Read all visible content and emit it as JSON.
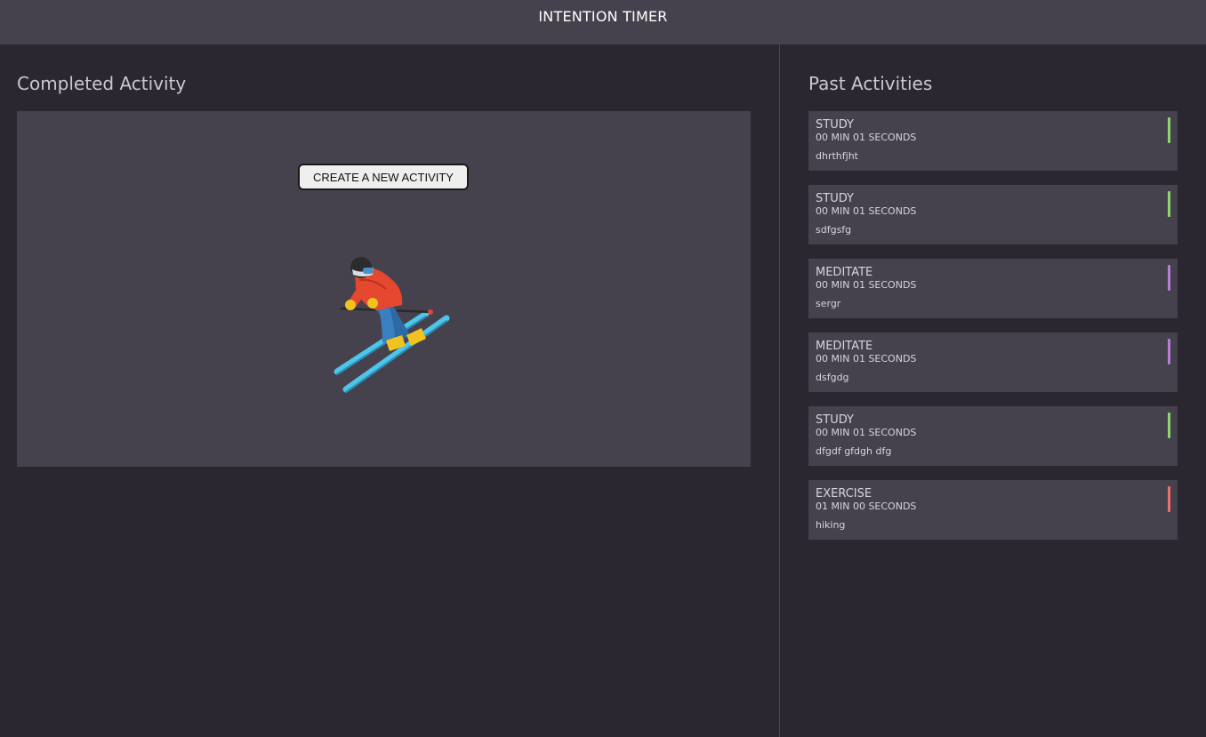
{
  "header": {
    "title": "INTENTION TIMER"
  },
  "main": {
    "heading": "Completed Activity",
    "button_label": "CREATE A NEW ACTIVITY",
    "illustration": "skier-emoji"
  },
  "sidebar": {
    "heading": "Past Activities",
    "activities": [
      {
        "category": "STUDY",
        "duration": "00 MIN 01 SECONDS",
        "description": "dhrthfjht",
        "accent_color": "#8fd66e"
      },
      {
        "category": "STUDY",
        "duration": "00 MIN 01 SECONDS",
        "description": "sdfgsfg",
        "accent_color": "#8fd66e"
      },
      {
        "category": "MEDITATE",
        "duration": "00 MIN 01 SECONDS",
        "description": "sergr",
        "accent_color": "#b77dd8"
      },
      {
        "category": "MEDITATE",
        "duration": "00 MIN 01 SECONDS",
        "description": "dsfgdg",
        "accent_color": "#b77dd8"
      },
      {
        "category": "STUDY",
        "duration": "00 MIN 01 SECONDS",
        "description": "dfgdf gfdgh dfg",
        "accent_color": "#8fd66e"
      },
      {
        "category": "EXERCISE",
        "duration": "01 MIN 00 SECONDS",
        "description": "hiking",
        "accent_color": "#ef6f6c"
      }
    ]
  }
}
